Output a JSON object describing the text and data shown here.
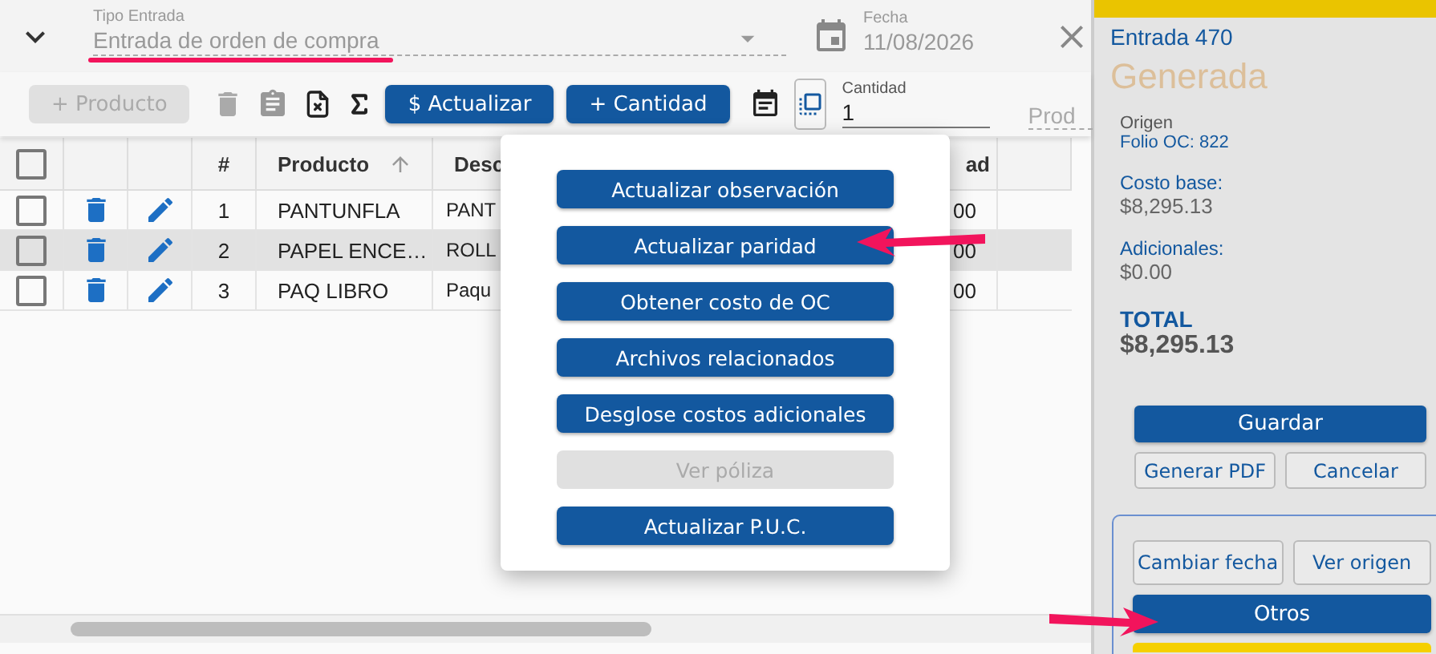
{
  "header": {
    "type_field": {
      "label": "Tipo Entrada",
      "value": "Entrada de orden de compra",
      "disabled": true
    },
    "date_field": {
      "label": "Fecha",
      "value": "11/08/2026",
      "disabled": true
    }
  },
  "toolbar": {
    "add_button": {
      "label": "+ Producto",
      "disabled": true
    },
    "update_button": "$ Actualizar",
    "quantity_button": "+ Cantidad",
    "quantity_field": {
      "label": "Cantidad",
      "value": "1"
    },
    "product_field": {
      "placeholder": "Prod"
    }
  },
  "table": {
    "header_checked": false,
    "columns": [
      {
        "label": "#"
      },
      {
        "label": "Producto"
      },
      {
        "label": "Desc"
      },
      {
        "label": "ad"
      }
    ],
    "rows": [
      {
        "checked": false,
        "selected": false,
        "number": "1",
        "product": "PANTUNFLA",
        "description": "PANT",
        "column_4": "00"
      },
      {
        "checked": false,
        "selected": true,
        "number": "2",
        "product": "PAPEL ENCE…",
        "description": "ROLL",
        "column_4": "00"
      },
      {
        "checked": false,
        "selected": false,
        "number": "3",
        "product": "PAQ LIBRO",
        "description": "Paqu",
        "column_4": "00"
      }
    ]
  },
  "menu": {
    "items": [
      {
        "label": "Actualizar observación",
        "disabled": false
      },
      {
        "label": "Actualizar paridad",
        "disabled": false
      },
      {
        "label": "Obtener costo de OC",
        "disabled": false
      },
      {
        "label": "Archivos relacionados",
        "disabled": false
      },
      {
        "label": "Desglose costos adicionales",
        "disabled": false
      },
      {
        "label": "Ver póliza",
        "disabled": true
      },
      {
        "label": "Actualizar P.U.C.",
        "disabled": false
      }
    ]
  },
  "summary": {
    "title": "Entrada 470",
    "status": "Generada",
    "origin_label": "Origen",
    "origin_link": "Folio OC: 822",
    "fields": [
      {
        "label": "Costo base:",
        "value": "$8,295.13"
      },
      {
        "label": "Adicionales:",
        "value": "$0.00"
      }
    ],
    "total_label": "TOTAL",
    "total_value": "$8,295.13",
    "save_button": "Guardar",
    "pdf_button": "Generar PDF",
    "cancel_button": "Cancelar",
    "other_actions": {
      "change_date": "Cambiar fecha",
      "view_origin": "Ver origen",
      "more": "Otros"
    }
  }
}
